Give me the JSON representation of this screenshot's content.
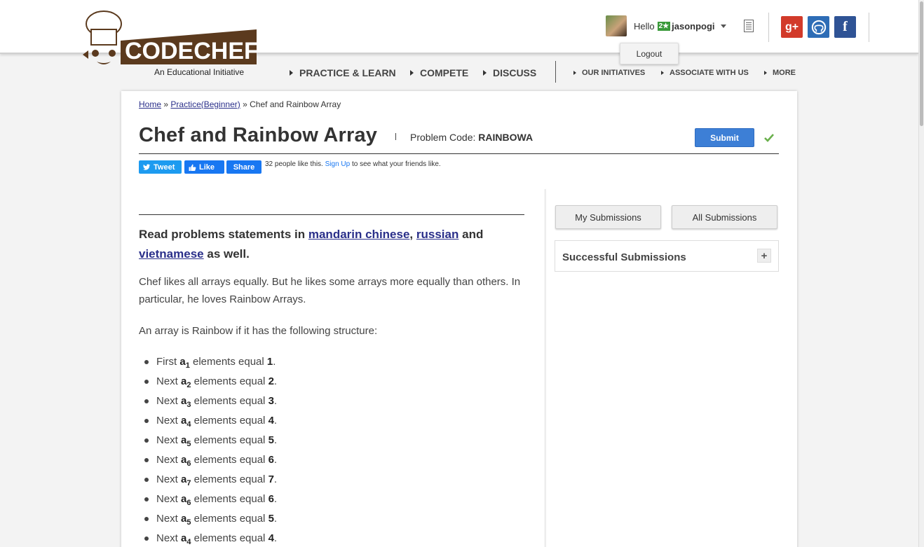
{
  "header": {
    "logo_text": "CODECHEF",
    "logo_subtitle": "An Educational Initiative",
    "greeting": "Hello",
    "rating_badge": "2★",
    "username": "jasonpogi",
    "logout_label": "Logout",
    "social": {
      "gplus": "g+",
      "facebook": "f"
    }
  },
  "nav": {
    "primary": [
      "PRACTICE & LEARN",
      "COMPETE",
      "DISCUSS"
    ],
    "secondary": [
      "OUR INITIATIVES",
      "ASSOCIATE WITH US",
      "MORE"
    ]
  },
  "breadcrumb": {
    "home": "Home",
    "sep": "»",
    "practice": "Practice(Beginner)",
    "current": "Chef and Rainbow Array"
  },
  "problem": {
    "title": "Chef and Rainbow Array",
    "code_label": "Problem Code:",
    "code": "RAINBOWA",
    "submit_label": "Submit"
  },
  "share": {
    "tweet": "Tweet",
    "like": "Like",
    "share": "Share",
    "likes_text": "32 people like this.",
    "signup": "Sign Up",
    "likes_suffix": "to see what your friends like."
  },
  "statement": {
    "read_prefix": "Read problems statements in",
    "lang1": "mandarin chinese",
    "comma": ",",
    "lang2": "russian",
    "and": "and",
    "lang3": "vietnamese",
    "as_well": "as well.",
    "para1": "Chef likes all arrays equally. But he likes some arrays more equally than others. In particular, he loves Rainbow Arrays.",
    "para2": "An array is Rainbow if it has the following structure:",
    "items": [
      {
        "prefix": "First",
        "var": "a",
        "sub": "1",
        "mid": "elements equal",
        "val": "1"
      },
      {
        "prefix": "Next",
        "var": "a",
        "sub": "2",
        "mid": "elements equal",
        "val": "2"
      },
      {
        "prefix": "Next",
        "var": "a",
        "sub": "3",
        "mid": "elements equal",
        "val": "3"
      },
      {
        "prefix": "Next",
        "var": "a",
        "sub": "4",
        "mid": "elements equal",
        "val": "4"
      },
      {
        "prefix": "Next",
        "var": "a",
        "sub": "5",
        "mid": "elements equal",
        "val": "5"
      },
      {
        "prefix": "Next",
        "var": "a",
        "sub": "6",
        "mid": "elements equal",
        "val": "6"
      },
      {
        "prefix": "Next",
        "var": "a",
        "sub": "7",
        "mid": "elements equal",
        "val": "7"
      },
      {
        "prefix": "Next",
        "var": "a",
        "sub": "6",
        "mid": "elements equal",
        "val": "6"
      },
      {
        "prefix": "Next",
        "var": "a",
        "sub": "5",
        "mid": "elements equal",
        "val": "5"
      },
      {
        "prefix": "Next",
        "var": "a",
        "sub": "4",
        "mid": "elements equal",
        "val": "4"
      }
    ]
  },
  "sidebar": {
    "my_submissions": "My Submissions",
    "all_submissions": "All Submissions",
    "successful_submissions": "Successful Submissions",
    "expand": "+"
  },
  "colors": {
    "accent": "#3d7fd6",
    "link": "#2a2f8a",
    "logo_brown": "#5b3a1e"
  }
}
